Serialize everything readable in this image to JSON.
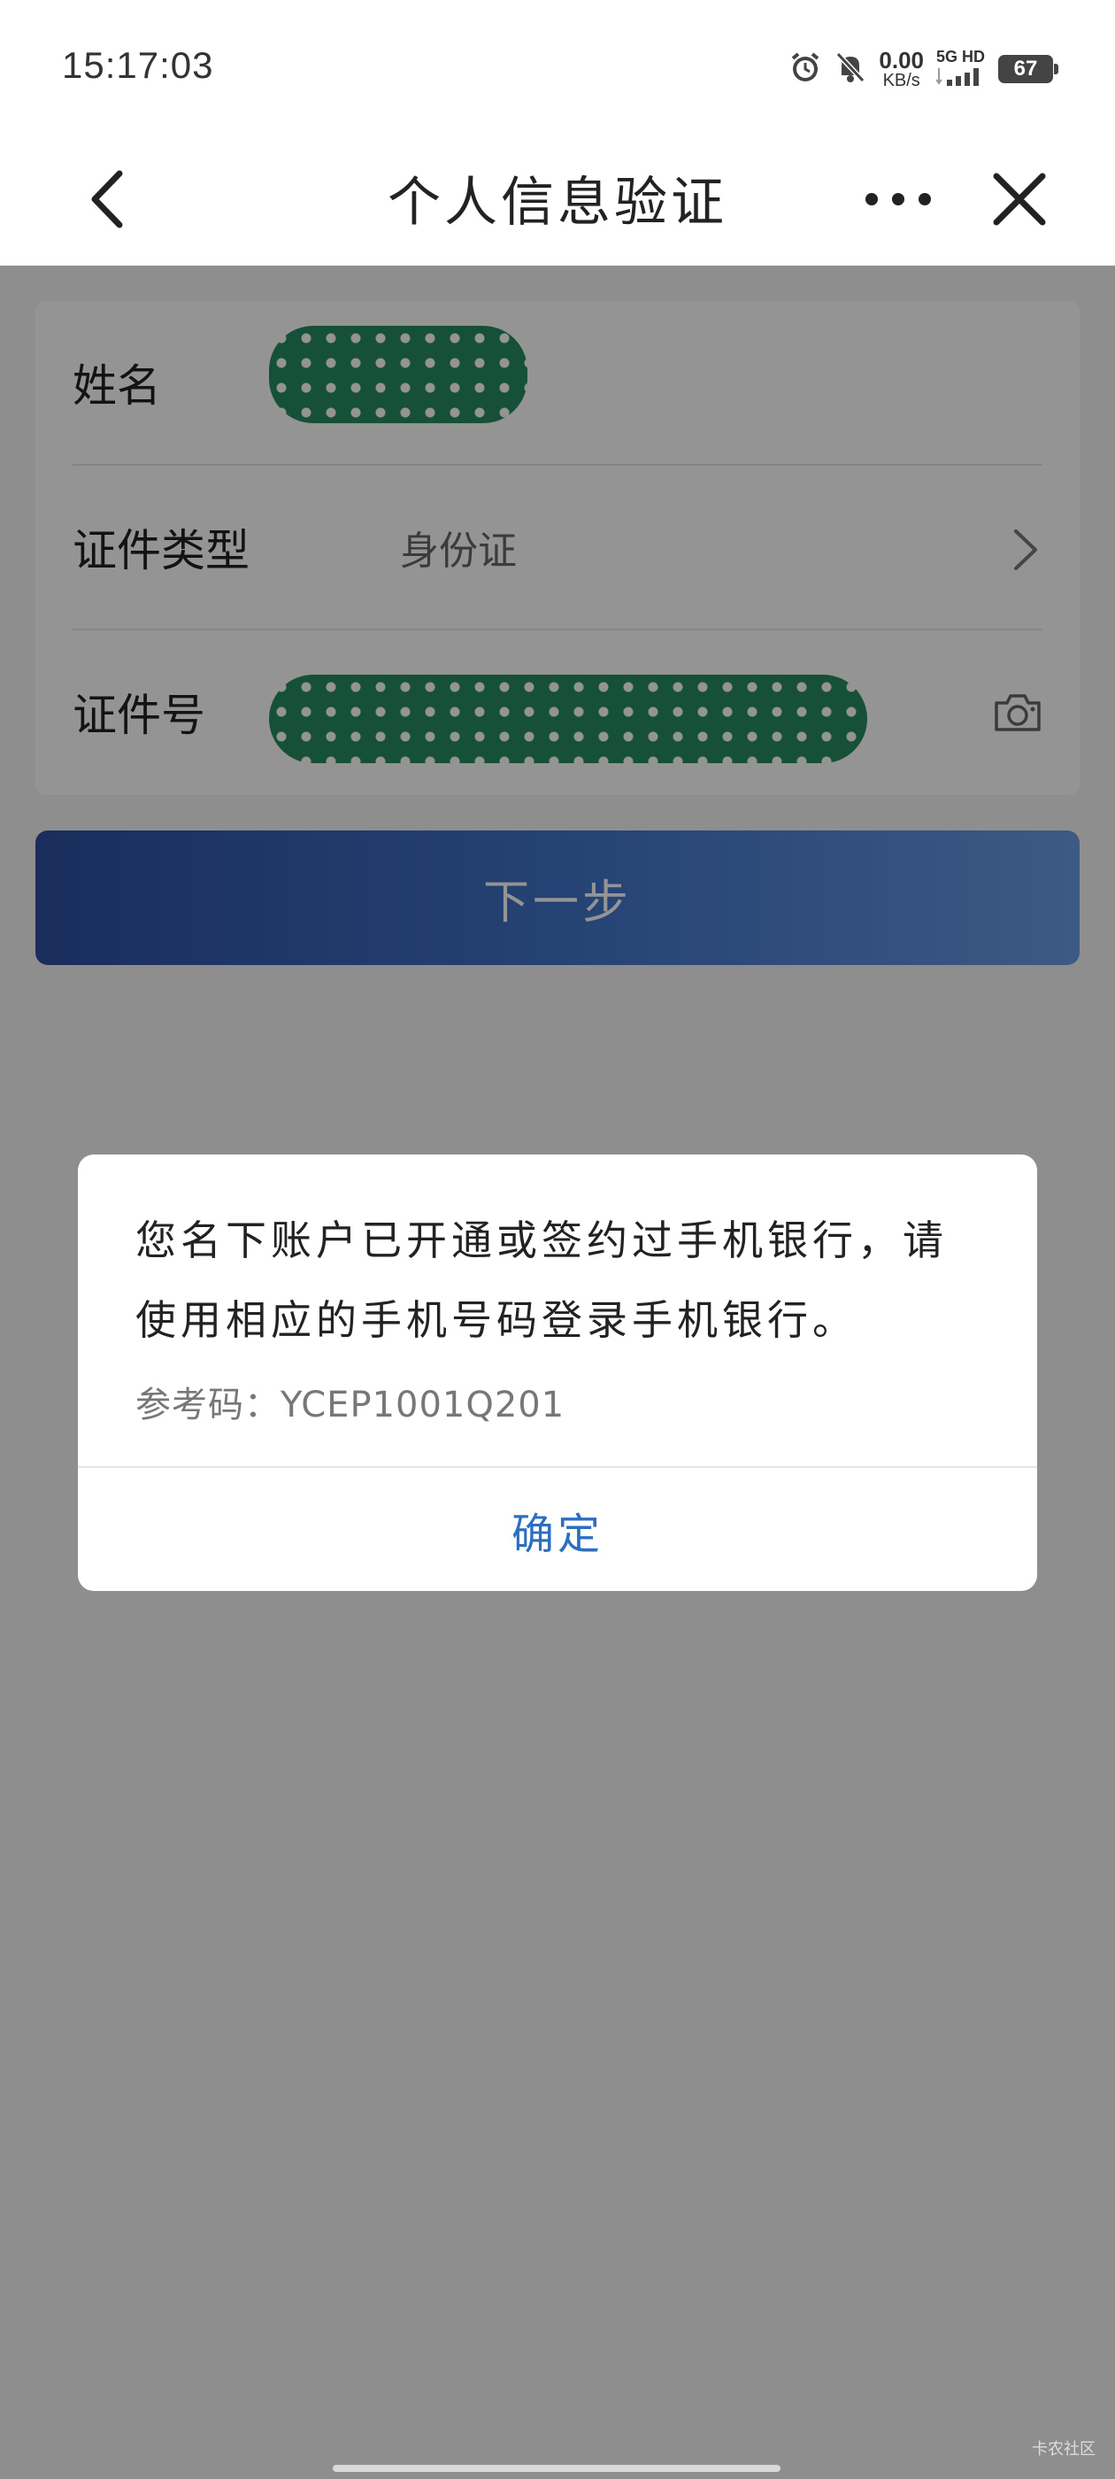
{
  "status_bar": {
    "time": "15:17:03",
    "network_speed_value": "0.00",
    "network_speed_unit": "KB/s",
    "network_label": "5G HD",
    "battery": "67",
    "icons": [
      "alarm-icon",
      "mute-icon",
      "signal-icon",
      "battery-icon"
    ]
  },
  "nav": {
    "title": "个人信息验证",
    "back_icon": "chevron-left-icon",
    "more_icon": "more-icon",
    "close_icon": "close-icon"
  },
  "form": {
    "name_label": "姓名",
    "id_type_label": "证件类型",
    "id_type_value": "身份证",
    "id_number_label": "证件号",
    "camera_icon": "camera-icon"
  },
  "next_button": "下一步",
  "dialog": {
    "message": "您名下账户已开通或签约过手机银行，请使用相应的手机号码登录手机银行。",
    "reference_code": "参考码：YCEP1001Q201",
    "confirm": "确定"
  },
  "watermark": "卡农社区",
  "colors": {
    "accent": "#2c6fc0",
    "button_gradient_start": "#2e4f9f",
    "button_gradient_end": "#6a9be3",
    "redaction": "#268a63"
  }
}
